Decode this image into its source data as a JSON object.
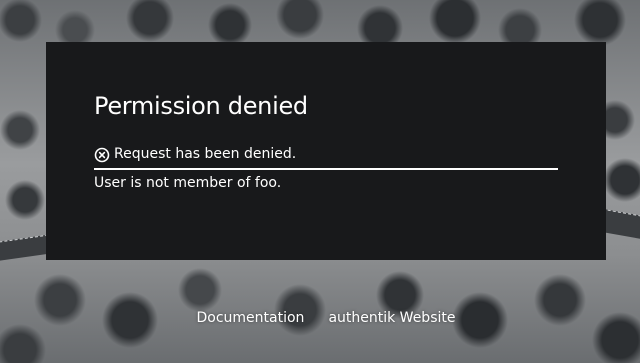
{
  "card": {
    "title": "Permission denied",
    "message": "Request has been denied.",
    "message_icon": "circle-x-icon",
    "detail": "User is not member of foo."
  },
  "footer": {
    "links": [
      {
        "label": "Documentation"
      },
      {
        "label": "authentik Website"
      }
    ]
  },
  "colors": {
    "card_background": "#18191b",
    "text": "#ffffff"
  }
}
